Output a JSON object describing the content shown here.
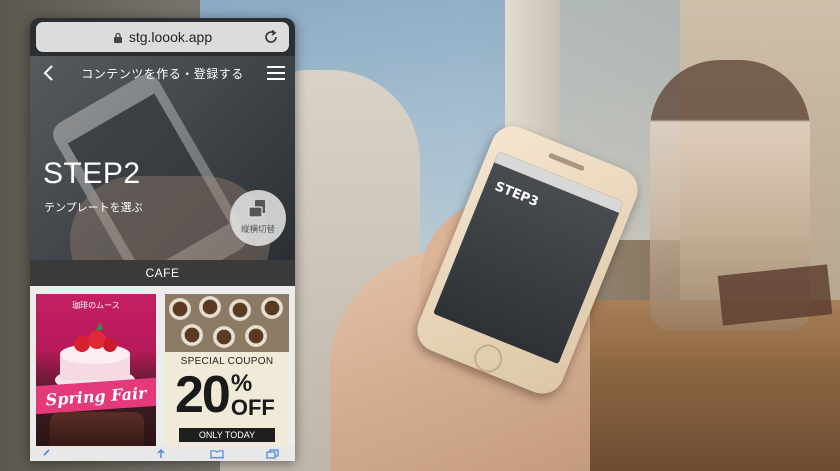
{
  "browser": {
    "url": "stg.loook.app"
  },
  "nav": {
    "title": "コンテンツを作る・登録する"
  },
  "hero": {
    "step_title": "STEP2",
    "step_subtitle": "テンプレートを選ぶ",
    "switch_label": "縦横切替"
  },
  "category": {
    "label": "CAFE"
  },
  "templates": [
    {
      "name": "cafe-cake-template",
      "header": "珈琲のムース",
      "script_text": "Spring Fair"
    },
    {
      "name": "coupon-template",
      "heading": "SPECIAL COUPON",
      "number": "20",
      "percent": "%",
      "off": "OFF",
      "footer": "ONLY TODAY"
    }
  ],
  "held_phone": {
    "screen_title": "STEP3"
  },
  "colors": {
    "cafe_pink": "#c51f63",
    "coupon_bg": "#f1ead8",
    "category_bar": "#3a3a3a"
  },
  "icons": [
    "lock-icon",
    "reload-icon",
    "back-icon",
    "menu-icon",
    "orientation-switch-icon",
    "share-icon",
    "bookmarks-icon",
    "tabs-icon"
  ]
}
